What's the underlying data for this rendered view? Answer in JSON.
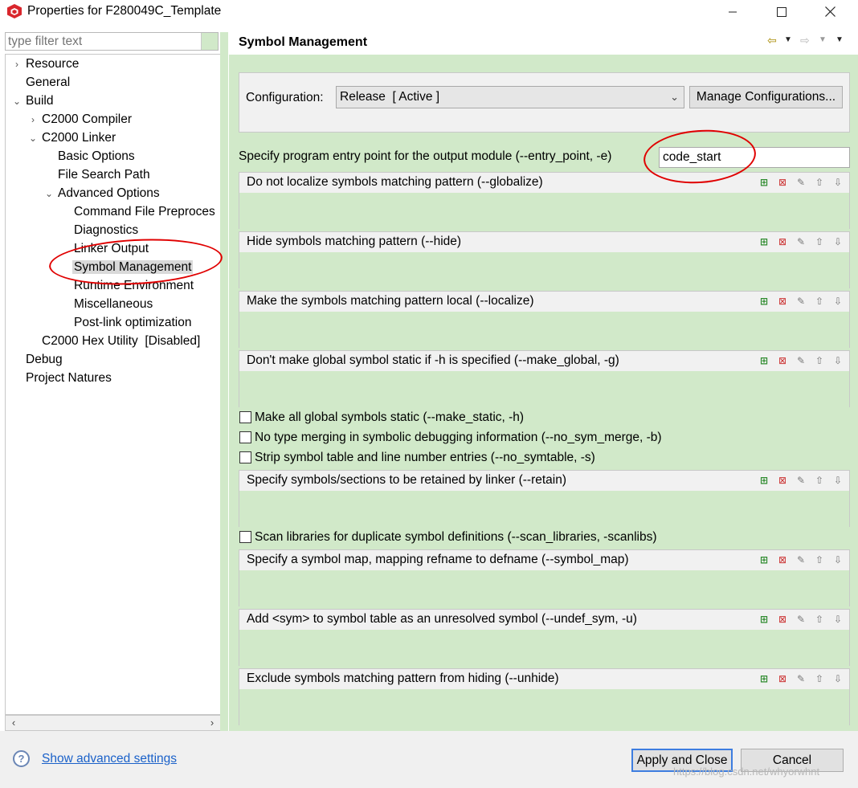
{
  "window": {
    "title": "Properties for F280049C_Template"
  },
  "filter": {
    "placeholder": "type filter text"
  },
  "tree": [
    {
      "label": "Resource"
    },
    {
      "label": "General"
    },
    {
      "label": "Build"
    },
    {
      "label": "C2000 Compiler"
    },
    {
      "label": "C2000 Linker"
    },
    {
      "label": "Basic Options"
    },
    {
      "label": "File Search Path"
    },
    {
      "label": "Advanced Options"
    },
    {
      "label": "Command File Preproces"
    },
    {
      "label": "Diagnostics"
    },
    {
      "label": "Linker Output"
    },
    {
      "label": "Symbol Management",
      "selected": true
    },
    {
      "label": "Runtime Environment"
    },
    {
      "label": "Miscellaneous"
    },
    {
      "label": "Post-link optimization"
    },
    {
      "label": "C2000 Hex Utility  [Disabled]"
    },
    {
      "label": "Debug"
    },
    {
      "label": "Project Natures"
    }
  ],
  "page": {
    "title": "Symbol Management"
  },
  "config": {
    "label": "Configuration:",
    "value": "Release  [ Active ]",
    "manage_label": "Manage Configurations..."
  },
  "entry": {
    "label": "Specify program entry point for the output module (--entry_point, -e)",
    "value": "code_start"
  },
  "lists": [
    {
      "title": "Do not localize symbols matching pattern (--globalize)"
    },
    {
      "title": "Hide symbols matching pattern (--hide)"
    },
    {
      "title": "Make the symbols matching pattern local (--localize)"
    },
    {
      "title": "Don't make global symbol static if -h is specified (--make_global, -g)"
    },
    {
      "title": "Specify symbols/sections to be retained by linker (--retain)"
    },
    {
      "title": "Specify a symbol map, mapping refname to defname (--symbol_map)"
    },
    {
      "title": "Add <sym> to symbol table as an unresolved symbol (--undef_sym, -u)"
    },
    {
      "title": "Exclude symbols matching pattern from hiding (--unhide)"
    }
  ],
  "checks": [
    {
      "label": "Make all global symbols static (--make_static, -h)",
      "checked": false
    },
    {
      "label": "No type merging in symbolic debugging information (--no_sym_merge, -b)",
      "checked": false
    },
    {
      "label": "Strip symbol table and line number entries (--no_symtable, -s)",
      "checked": false
    },
    {
      "label": "Scan libraries for duplicate symbol definitions (--scan_libraries, -scanlibs)",
      "checked": false
    }
  ],
  "bottom": {
    "help_symbol": "?",
    "advanced_link": "Show advanced settings",
    "apply_close": "Apply and Close",
    "cancel": "Cancel",
    "watermark": "https://blog.csdn.net/whyorwhnt"
  },
  "icons": {
    "app": "cube-icon",
    "minimize": "minimize-icon",
    "maximize": "maximize-icon",
    "close": "close-icon",
    "back": "back-arrow-icon",
    "forward": "forward-arrow-icon",
    "add": "add-icon",
    "delete": "delete-icon",
    "edit": "edit-icon",
    "move_up": "move-up-icon",
    "move_down": "move-down-icon"
  },
  "colors": {
    "panel_green": "#d1e9c9",
    "annotation_red": "#e00000",
    "link_blue": "#1a61c9",
    "focus_blue": "#3d7de0"
  }
}
